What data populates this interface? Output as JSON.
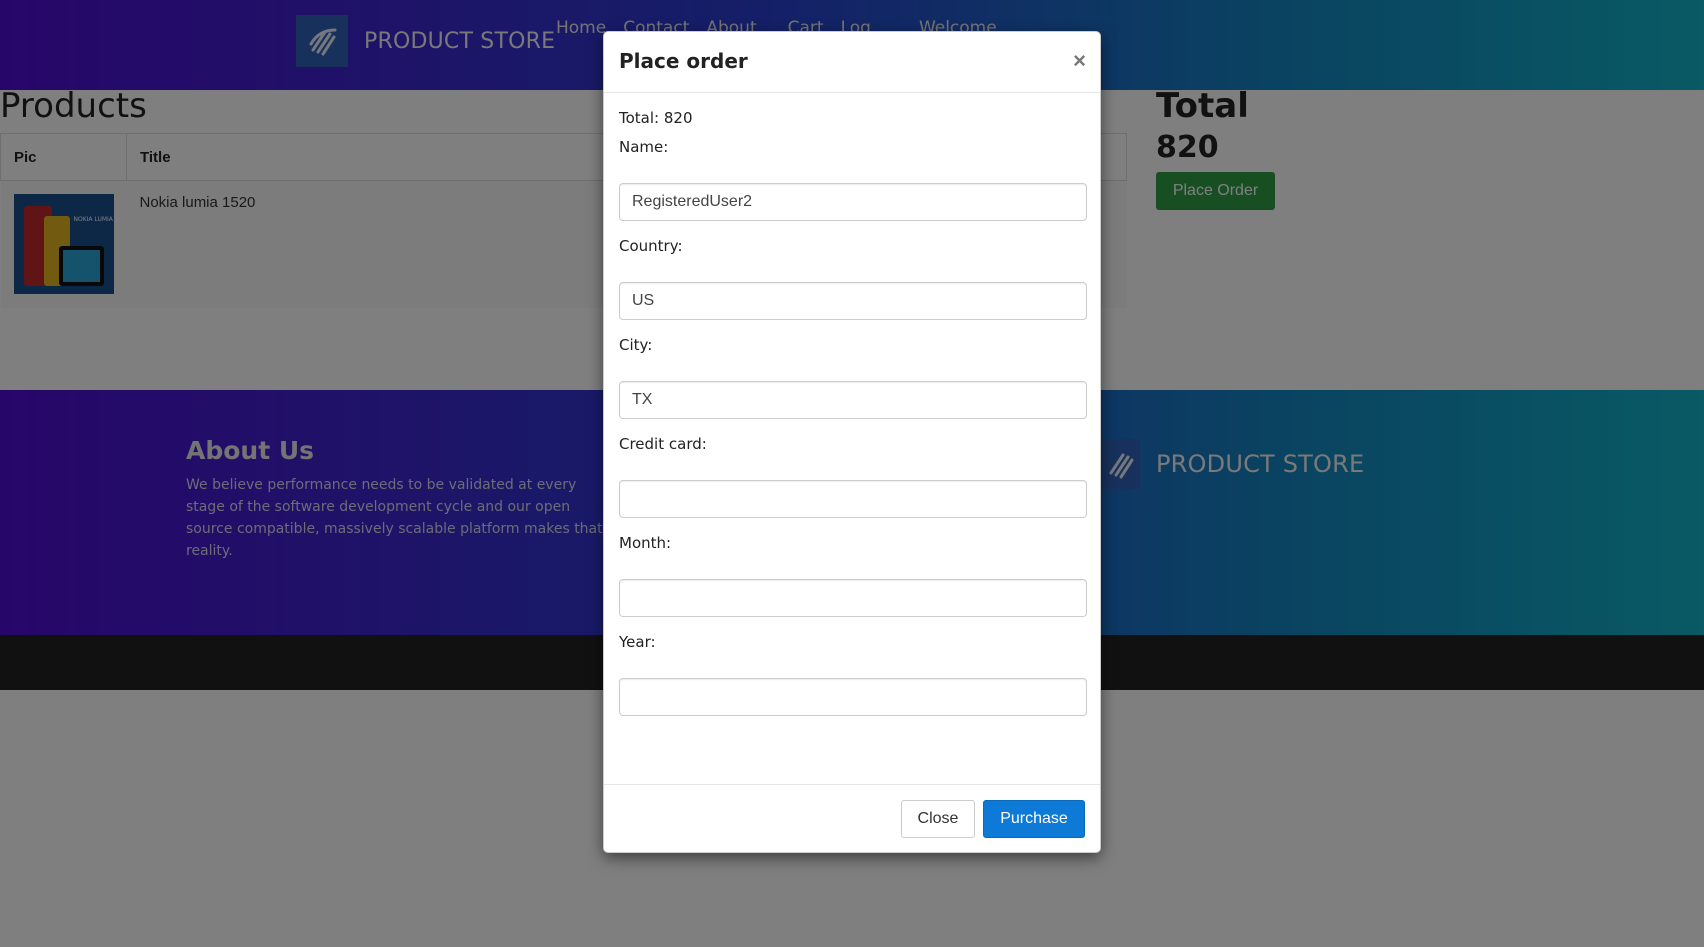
{
  "navbar": {
    "brand": "PRODUCT STORE",
    "links": [
      "Home",
      "Contact",
      "About",
      "Cart",
      "Log",
      "Welcome"
    ],
    "logo_icon": "rocket-logo-icon"
  },
  "products": {
    "title": "Products",
    "columns": [
      "Pic",
      "Title"
    ],
    "rows": [
      {
        "title": "Nokia lumia 1520",
        "image_label": "NOKIA LUMIA"
      }
    ]
  },
  "total": {
    "title": "Total",
    "value": "820",
    "place_order_label": "Place Order"
  },
  "footer": {
    "about_title": "About Us",
    "about_text": "We believe performance needs to be validated at every stage of the software development cycle and our open source compatible, massively scalable platform makes that a reality.",
    "brand": "PRODUCT STORE"
  },
  "modal": {
    "title": "Place order",
    "close_symbol": "×",
    "total_text": "Total: 820",
    "fields": {
      "name": {
        "label": "Name:",
        "value": "RegisteredUser2"
      },
      "country": {
        "label": "Country:",
        "value": "US"
      },
      "city": {
        "label": "City:",
        "value": "TX"
      },
      "card": {
        "label": "Credit card:",
        "value": ""
      },
      "month": {
        "label": "Month:",
        "value": ""
      },
      "year": {
        "label": "Year:",
        "value": ""
      }
    },
    "close_label": "Close",
    "purchase_label": "Purchase"
  },
  "colors": {
    "gradient_start": "#4f0dd3",
    "gradient_end": "#12b4c9",
    "place_order_green": "#2e9e46",
    "purchase_blue": "#0d7ad8"
  }
}
